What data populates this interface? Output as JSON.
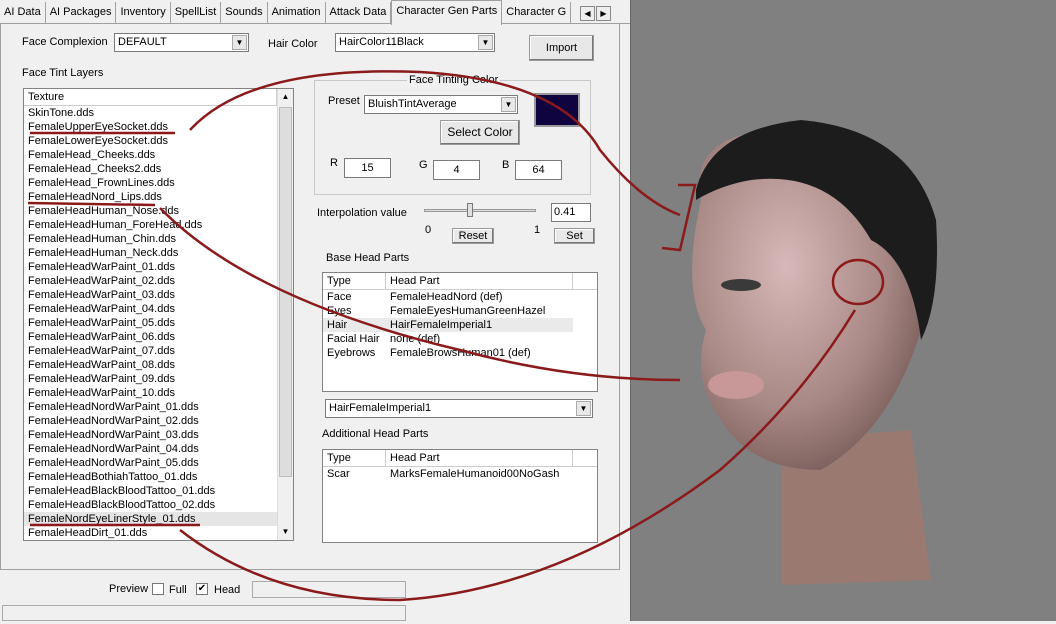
{
  "tabs": [
    "AI Data",
    "AI Packages",
    "Inventory",
    "SpellList",
    "Sounds",
    "Animation",
    "Attack Data",
    "Character Gen Parts",
    "Character G"
  ],
  "active_tab": "Character Gen Parts",
  "face_complexion": {
    "label": "Face Complexion",
    "value": "DEFAULT"
  },
  "hair_color": {
    "label": "Hair Color",
    "value": "HairColor11Black"
  },
  "import_label": "Import",
  "tint_layers": {
    "label": "Face Tint Layers",
    "column": "Texture",
    "selected": "FemaleNordEyeLinerStyle_01.dds",
    "items": [
      "SkinTone.dds",
      "FemaleUpperEyeSocket.dds",
      "FemaleLowerEyeSocket.dds",
      "FemaleHead_Cheeks.dds",
      "FemaleHead_Cheeks2.dds",
      "FemaleHead_FrownLines.dds",
      "FemaleHeadNord_Lips.dds",
      "FemaleHeadHuman_Nose.dds",
      "FemaleHeadHuman_ForeHead.dds",
      "FemaleHeadHuman_Chin.dds",
      "FemaleHeadHuman_Neck.dds",
      "FemaleHeadWarPaint_01.dds",
      "FemaleHeadWarPaint_02.dds",
      "FemaleHeadWarPaint_03.dds",
      "FemaleHeadWarPaint_04.dds",
      "FemaleHeadWarPaint_05.dds",
      "FemaleHeadWarPaint_06.dds",
      "FemaleHeadWarPaint_07.dds",
      "FemaleHeadWarPaint_08.dds",
      "FemaleHeadWarPaint_09.dds",
      "FemaleHeadWarPaint_10.dds",
      "FemaleHeadNordWarPaint_01.dds",
      "FemaleHeadNordWarPaint_02.dds",
      "FemaleHeadNordWarPaint_03.dds",
      "FemaleHeadNordWarPaint_04.dds",
      "FemaleHeadNordWarPaint_05.dds",
      "FemaleHeadBothiahTattoo_01.dds",
      "FemaleHeadBlackBloodTattoo_01.dds",
      "FemaleHeadBlackBloodTattoo_02.dds",
      "FemaleNordEyeLinerStyle_01.dds",
      "FemaleHeadDirt_01.dds"
    ]
  },
  "tinting": {
    "title": "Face Tinting Color",
    "preset_label": "Preset",
    "preset": "BluishTintAverage",
    "select_color": "Select Color",
    "swatch": "#0f0440",
    "r_label": "R",
    "r": "15",
    "g_label": "G",
    "g": "4",
    "b_label": "B",
    "b": "64"
  },
  "interpolation": {
    "label": "Interpolation value",
    "value": 0.41,
    "value_text": "0.41",
    "min": "0",
    "max": "1",
    "reset": "Reset",
    "set": "Set"
  },
  "base_head_parts": {
    "label": "Base Head Parts",
    "columns": [
      "Type",
      "Head Part"
    ],
    "selected": "Hair",
    "rows": [
      [
        "Face",
        "FemaleHeadNord (def)"
      ],
      [
        "Eyes",
        "FemaleEyesHumanGreenHazel"
      ],
      [
        "Hair",
        "HairFemaleImperial1"
      ],
      [
        "Facial Hair",
        "none (def)"
      ],
      [
        "Eyebrows",
        "FemaleBrowsHuman01 (def)"
      ]
    ],
    "part_select": "HairFemaleImperial1"
  },
  "additional_head_parts": {
    "label": "Additional Head Parts",
    "columns": [
      "Type",
      "Head Part"
    ],
    "rows": [
      [
        "Scar",
        "MarksFemaleHumanoid00NoGash"
      ]
    ]
  },
  "preview": {
    "label": "Preview",
    "full": "Full",
    "full_checked": false,
    "head": "Head",
    "head_checked": true
  },
  "annotation_color": "#8b1a1a"
}
